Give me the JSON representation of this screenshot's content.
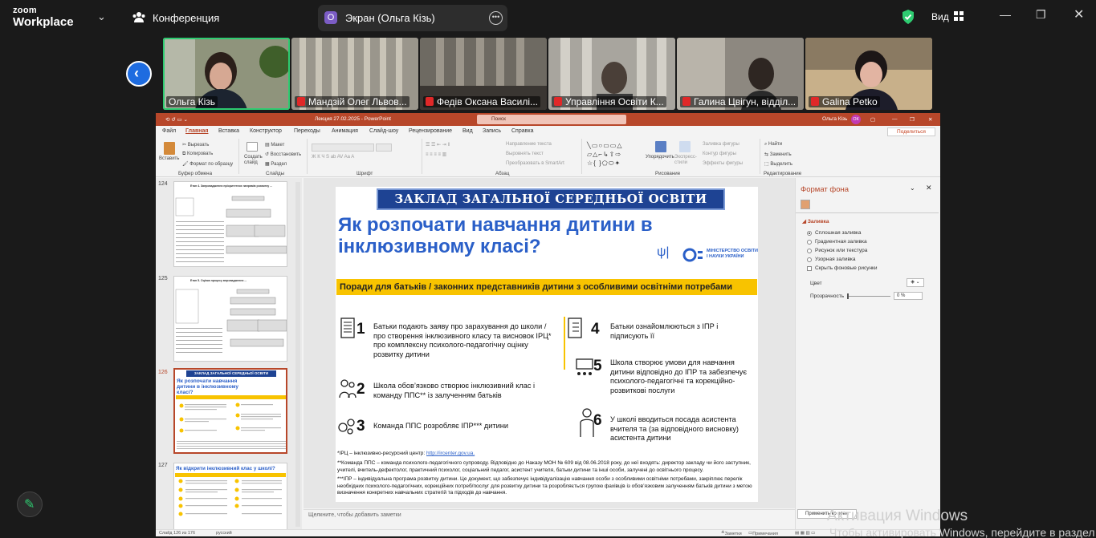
{
  "zoom": {
    "logo_line1": "zoom",
    "logo_line2": "Workplace",
    "meeting_label": "Конференция",
    "share_label": "Экран (Ольга Кізь)",
    "view_label": "Вид",
    "colors": {
      "accent": "#1e6ce0",
      "active_speaker": "#2ecc71",
      "muted": "#e02828"
    }
  },
  "participants": [
    {
      "name": "Ольга Кізь",
      "muted": false,
      "active": true
    },
    {
      "name": "Мандзій Олег Львов...",
      "muted": true
    },
    {
      "name": "Федів Оксана Василі...",
      "muted": true
    },
    {
      "name": "Управління Освіти К...",
      "muted": true
    },
    {
      "name": "Галина Цвігун, відділ...",
      "muted": true
    },
    {
      "name": "Galina Petko",
      "muted": true
    }
  ],
  "ppt": {
    "title": "Лекция 27.02.2025  -  PowerPoint",
    "search": "Поиск",
    "user": "Ольга Кізь",
    "user_initials": "ОК",
    "share": "Поделиться",
    "menu": [
      "Файл",
      "Главная",
      "Вставка",
      "Конструктор",
      "Переходы",
      "Анимация",
      "Слайд-шоу",
      "Рецензирование",
      "Вид",
      "Запись",
      "Справка"
    ],
    "ribbon": {
      "paste": "Вставить",
      "cut": "Вырезать",
      "copy": "Копировать",
      "format_painter": "Формат по образцу",
      "clipboard": "Буфер обмена",
      "new_slide": "Создать слайд",
      "layout": "Макет",
      "reset": "Восстановить",
      "section": "Раздел",
      "slides": "Слайды",
      "font": "Шрифт",
      "text_dir": "Направление текста",
      "align_text": "Выровнять текст",
      "smartart": "Преобразовать в SmartArt",
      "paragraph": "Абзац",
      "arrange": "Упорядочить",
      "quick_styles": "Экспресс-стили",
      "fill": "Заливка фигуры",
      "outline": "Контур фигуры",
      "effects": "Эффекты фигуры",
      "drawing": "Рисование",
      "find": "Найти",
      "replace": "Заменить",
      "select": "Выделить",
      "editing": "Редактирование"
    },
    "slide_numbers": [
      "124",
      "125",
      "126",
      "127"
    ],
    "slide_thumb_titles": {
      "s124": "Етап 4. Запровадження пріоритетних напрямів розвитку ...",
      "s125": "Етап 5. Оцінка процесу впровадження ...",
      "s126a": "ЗАКЛАД ЗАГАЛЬНОЇ СЕРЕДНЬОЇ ОСВІТИ",
      "s126b": "Як розпочати навчання дитини в інклюзивному класі?",
      "s127": "Як відкрити інклюзивний клас у школі?"
    },
    "notes": "Щелкните, чтобы добавить заметки",
    "status": {
      "slide": "Слайд 126 из 176",
      "lang": "русский",
      "notes": "Заметки",
      "comments": "Примечания"
    }
  },
  "slide": {
    "header": "ЗАКЛАД ЗАГАЛЬНОЇ СЕРЕДНЬОЇ ОСВІТИ",
    "title_line1": "Як розпочати навчання дитини в",
    "title_line2": "інклюзивному класі?",
    "ministry": "МІНІСТЕРСТВО ОСВІТИ І НАУКИ УКРАЇНИ",
    "bar": "Поради для батьків / законних представників дитини з особливими освітніми потребами",
    "items": [
      {
        "n": "1",
        "text": "Батьки подають заяву про зарахування до школи / про створення інклюзивного класу та висновок ІРЦ* про комплексну психолого-педагогічну оцінку розвитку дитини"
      },
      {
        "n": "2",
        "text": "Школа обов’язково створює інклюзивний клас і команду ППС** із залученням батьків"
      },
      {
        "n": "3",
        "text": "Команда ППС розробляє ІПР*** дитини"
      },
      {
        "n": "4",
        "text": "Батьки ознайомлюються з ІПР і підписують її"
      },
      {
        "n": "5",
        "text": "Школа створює умови для навчання дитини відповідно до ІПР та забезпечує психолого-педагогічні та корекційно-розвиткові послуги"
      },
      {
        "n": "6",
        "text": "У школі вводиться посада асистента вчителя та (за відповідного висновку) асистента дитини"
      }
    ],
    "foot1a": "*ІРЦ – інклюзивно-ресурсний центр: ",
    "foot1b": "http://ircenter.gov.ua.",
    "foot2": "**Команда ППС – команда психолого-педагогічного супроводу. Відповідно до Наказу МОН № 609 від 08.06.2018 року, до неї входять: директор закладу чи його заступник, учителі, вчитель-дефектолог, практичний психолог, соціальний педагог, асистент учителя, батьки дитини та інші особи, залучені до освітнього процесу.",
    "foot3": "***ІПР – індивідуальна програма розвитку дитини. Це документ, що забезпечує індивідуалізацію навчання особи з особливими освітніми потребами, закріплює перелік необхідних психолого-педагогічних, корекційних потреб/послуг для розвитку дитини та розробляється групою фахівців із обов’язковим залученням батьків дитини з метою визначення конкретних навчальних стратегій та підходів до навчання.",
    "colors": {
      "blue": "#2a5fc8",
      "navy": "#1e4393",
      "yellow": "#f8c300"
    }
  },
  "format_pane": {
    "title": "Формат фона",
    "section": "Заливка",
    "options": [
      "Сплошная заливка",
      "Градиентная заливка",
      "Рисунок или текстура",
      "Узорная заливка"
    ],
    "hide_bg": "Скрыть фоновые рисунки",
    "color": "Цвет",
    "transparency": "Прозрачность",
    "transparency_value": "0 %",
    "apply_all": "Применить ко всем"
  },
  "windows_watermark": {
    "line1": "Активация Windows",
    "line2": "Чтобы активировать Windows, перейдите в раздел \"Настройки\", чтоб"
  }
}
